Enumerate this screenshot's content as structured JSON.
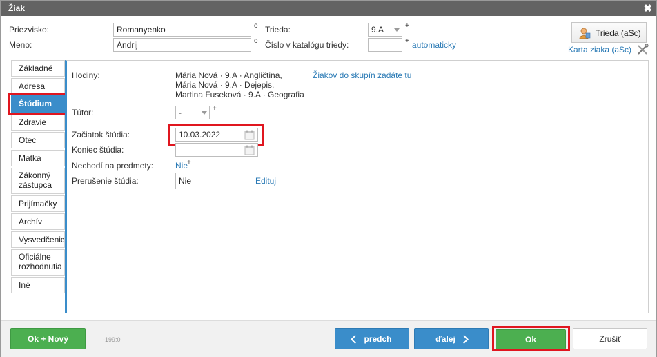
{
  "window": {
    "title": "Žiak",
    "close_glyph": "✖"
  },
  "header": {
    "surname_label": "Priezvisko:",
    "surname_value": "Romanyenko",
    "name_label": "Meno:",
    "name_value": "Andrij",
    "degree_mark": "o",
    "class_label": "Trieda:",
    "class_value": "9.A",
    "class_plus": "+",
    "catalog_label": "Číslo v katalógu triedy:",
    "catalog_value": "",
    "catalog_plus": "+",
    "catalog_auto": "automaticky",
    "trieda_button": "Trieda (aSc)",
    "card_link": "Karta ziaka (aSc)",
    "trieda_icon": "person-icon",
    "tools_icon": "tools-icon"
  },
  "tabs": [
    {
      "label": "Základné"
    },
    {
      "label": "Adresa"
    },
    {
      "label": "Štúdium",
      "active": true
    },
    {
      "label": "Zdravie"
    },
    {
      "label": "Otec"
    },
    {
      "label": "Matka"
    },
    {
      "label": "Zákonný zástupca"
    },
    {
      "label": "Prijímačky"
    },
    {
      "label": "Archív"
    },
    {
      "label": "Vysvedčenie"
    },
    {
      "label": "Oficiálne rozhodnutia"
    },
    {
      "label": "Iné"
    }
  ],
  "study": {
    "hours_label": "Hodiny:",
    "hours_lines": [
      "Mária Nová · 9.A · Angličtina,",
      "Mária Nová · 9.A · Dejepis,",
      "Martina Fuseková · 9.A · Geografia"
    ],
    "groups_link": "Žiakov do skupín zadáte tu",
    "tutor_label": "Tútor:",
    "tutor_value": "-",
    "tutor_plus": "+",
    "start_label": "Začiatok štúdia:",
    "start_value": "10.03.2022",
    "end_label": "Koniec štúdia:",
    "end_value": "",
    "calendar_icon": "calendar-icon",
    "absent_label": "Nechodí na predmety:",
    "absent_value": "Nie",
    "absent_plus": "+",
    "interrupt_label": "Prerušenie štúdia:",
    "interrupt_value": "Nie",
    "edit_link": "Edituj"
  },
  "footer": {
    "ok_new": "Ok + Nový",
    "code": "-199:0",
    "prev": "predch",
    "next": "ďalej",
    "ok": "Ok",
    "cancel": "Zrušiť"
  },
  "colors": {
    "titlebar": "#636363",
    "accent_blue": "#3a8dca",
    "ok_green": "#4caf50",
    "highlight_red": "#e0161f",
    "link": "#2a7ab5"
  }
}
